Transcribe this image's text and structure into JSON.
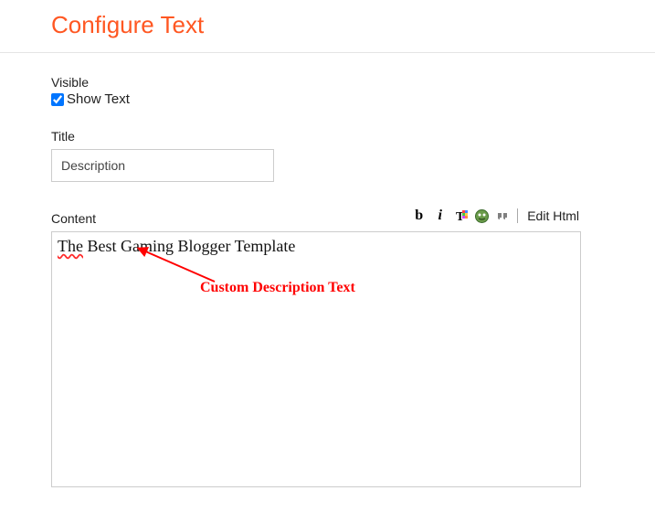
{
  "header": {
    "title": "Configure Text"
  },
  "visible": {
    "label": "Visible",
    "checkbox_label": "Show Text",
    "checked": true
  },
  "title_field": {
    "label": "Title",
    "value": "Description"
  },
  "content_field": {
    "label": "Content",
    "editor_value_underlined": "The",
    "editor_value_rest": " Best Gaming Blogger Template"
  },
  "toolbar": {
    "bold": "b",
    "italic": "i",
    "color_icon": "text-color-icon",
    "image_icon": "insert-image-icon",
    "quote_icon": "quote-icon",
    "edit_html": "Edit Html"
  },
  "annotation": {
    "text": "Custom Description Text"
  }
}
